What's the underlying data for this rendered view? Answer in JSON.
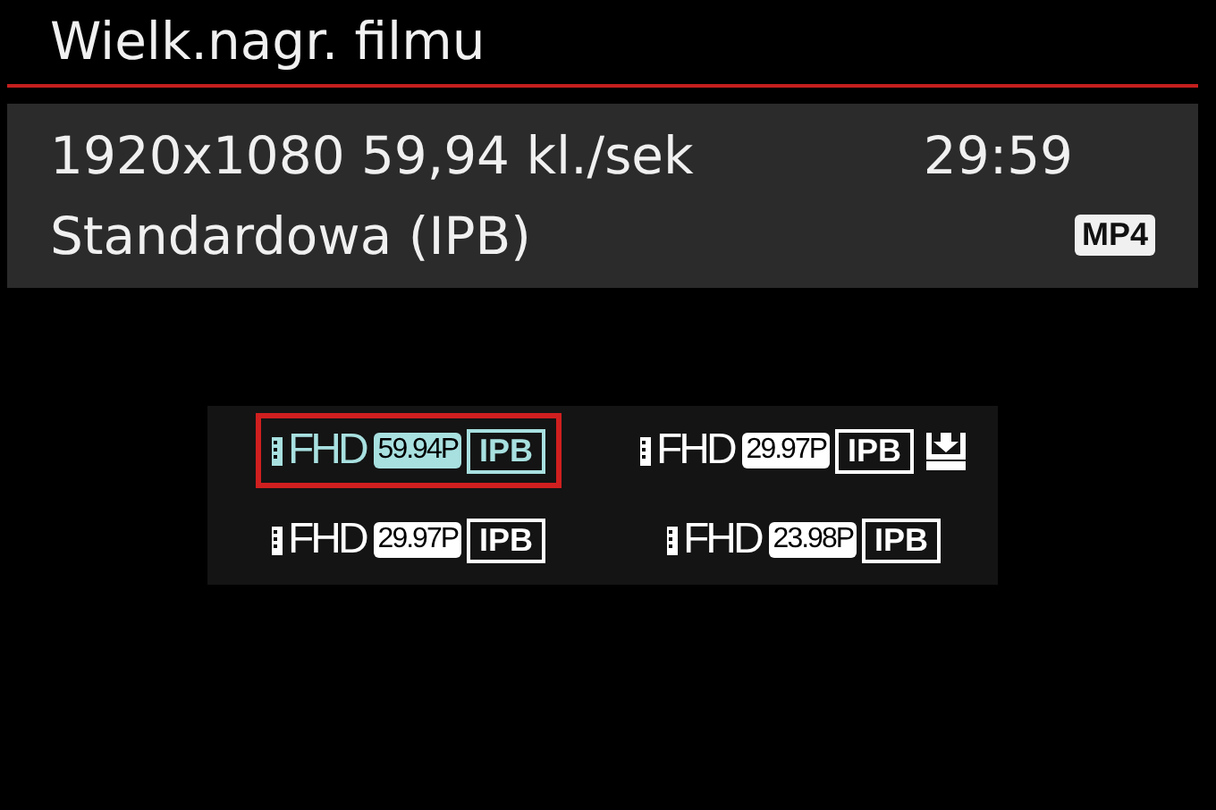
{
  "title": "Wielk.nagr. filmu",
  "summary": {
    "format": "1920x1080 59,94 kl./sek",
    "time": "29:59",
    "compression": "Standardowa (IPB)",
    "container": "MP4"
  },
  "options": [
    {
      "size": "FHD",
      "rate": "59.94P",
      "compression": "IPB",
      "selected": true,
      "download_icon": false
    },
    {
      "size": "FHD",
      "rate": "29.97P",
      "compression": "IPB",
      "selected": false,
      "download_icon": true
    },
    {
      "size": "FHD",
      "rate": "29.97P",
      "compression": "IPB",
      "selected": false,
      "download_icon": false
    },
    {
      "size": "FHD",
      "rate": "23.98P",
      "compression": "IPB",
      "selected": false,
      "download_icon": false
    }
  ]
}
